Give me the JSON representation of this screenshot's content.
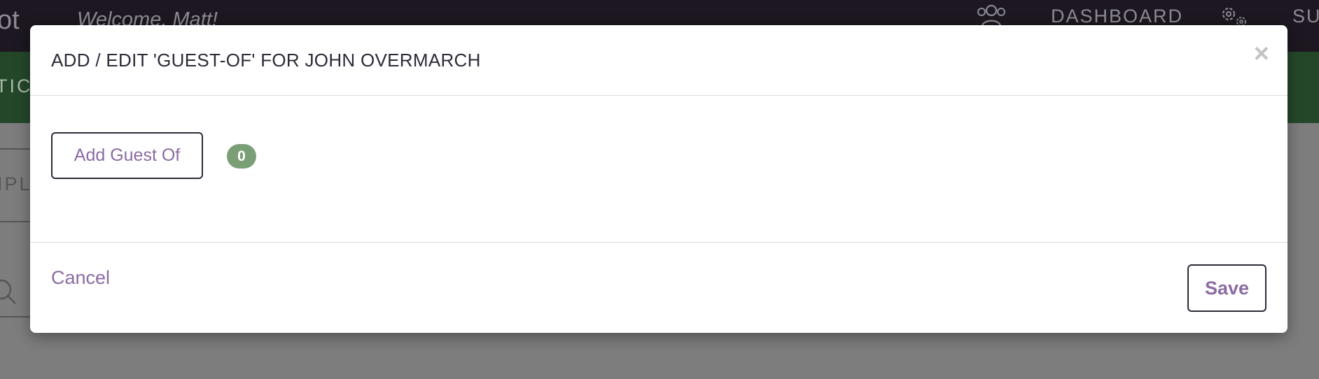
{
  "background": {
    "logo_fragment": "ot",
    "welcome": "Welcome, Matt!",
    "nav_dashboard": "DASHBOARD",
    "nav_support": "SU",
    "tab_fragment": "TICK",
    "field_fragment": "IPL",
    "icons": [
      "users-icon",
      "gear-icon",
      "search-icon"
    ]
  },
  "modal": {
    "title": "ADD / EDIT 'GUEST-OF' FOR JOHN OVERMARCH",
    "close_label": "×",
    "add_guest_label": "Add Guest Of",
    "guest_count": "0",
    "cancel_label": "Cancel",
    "save_label": "Save"
  },
  "colors": {
    "accent_purple": "#8b6ba3",
    "badge_green": "#7a9f77",
    "topbar": "#1c1720",
    "greenbar": "#24472a"
  }
}
